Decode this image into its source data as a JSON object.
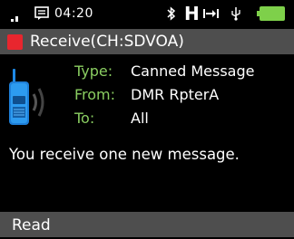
{
  "status_bar": {
    "time": "04:20",
    "icons": [
      "signal-icon",
      "message-icon",
      "bluetooth-icon",
      "h-icon",
      "arrow-icon",
      "usb-icon",
      "battery-icon"
    ],
    "colors": {
      "battery": "#7ed04a"
    }
  },
  "title_bar": {
    "title": "Receive(CH:SDVOA)",
    "indicator_color": "#e8262e"
  },
  "details": {
    "type_label": "Type:",
    "type_value": "Canned Message",
    "from_label": "From:",
    "from_value": "DMR RpterA",
    "to_label": "To:",
    "to_value": "All",
    "label_color": "#8acd61"
  },
  "message": "You receive one new message.",
  "bottom_bar": {
    "read_label": "Read"
  }
}
